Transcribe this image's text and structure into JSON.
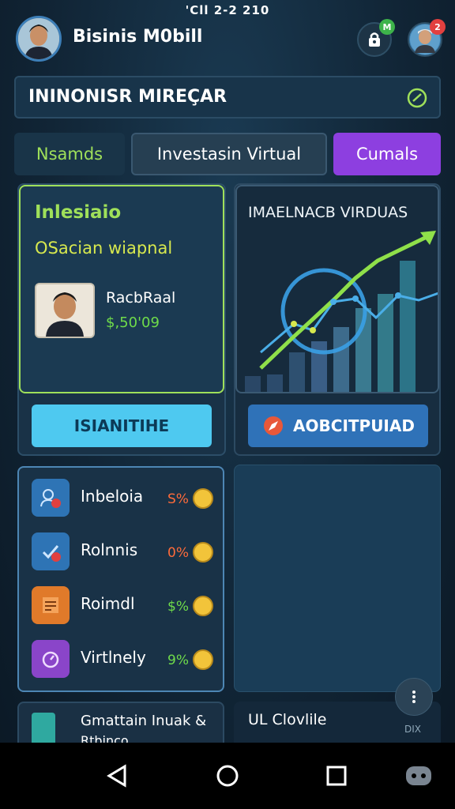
{
  "status_bar": {
    "time": "'Cll 2-2 210"
  },
  "header": {
    "title": "Bisinis M0bill",
    "lock_badge": "M",
    "profile_badge": "2"
  },
  "search": {
    "value": "ININONISR MIREÇAR"
  },
  "tabs": [
    {
      "label": "Nsamds",
      "active": false
    },
    {
      "label": "Investasin Virtual",
      "active": true
    },
    {
      "label": "Cumals",
      "active": false
    }
  ],
  "left_card": {
    "title": "Inlesiaio",
    "subtitle": "OSacian wiapnal",
    "profile_name": "RacbRaal",
    "profile_value": "$,50'09",
    "button_label": "ISIANITIHE"
  },
  "right_card": {
    "chart_title": "IMAELNACB VIRDUAS",
    "button_label": "AOBCITPUIAD"
  },
  "list": [
    {
      "label": "Inbeloia",
      "pct": "S%",
      "pct_color": "#ff6b3a",
      "icon": "users-icon",
      "icon_bg": "#2e74b5"
    },
    {
      "label": "Rolnnis",
      "pct": "0%",
      "pct_color": "#ff6b3a",
      "icon": "check-icon",
      "icon_bg": "#2e74b5"
    },
    {
      "label": "Roimdl",
      "pct": "$%",
      "pct_color": "#6fdc4a",
      "icon": "document-icon",
      "icon_bg": "#e07a2a"
    },
    {
      "label": "Virtlnely",
      "pct": "9%",
      "pct_color": "#6fdc4a",
      "icon": "clock-icon",
      "icon_bg": "#8a45c9"
    }
  ],
  "bottom_left": {
    "line1": "Gmattain Inuak &",
    "line2": "Rtbinco"
  },
  "bottom_right": {
    "label": "UL Clovlile"
  },
  "fab": {
    "label": "DIX"
  },
  "colors": {
    "accent_green": "#9fe05a",
    "accent_purple": "#8d3fe0",
    "accent_cyan": "#4ec9f0"
  }
}
